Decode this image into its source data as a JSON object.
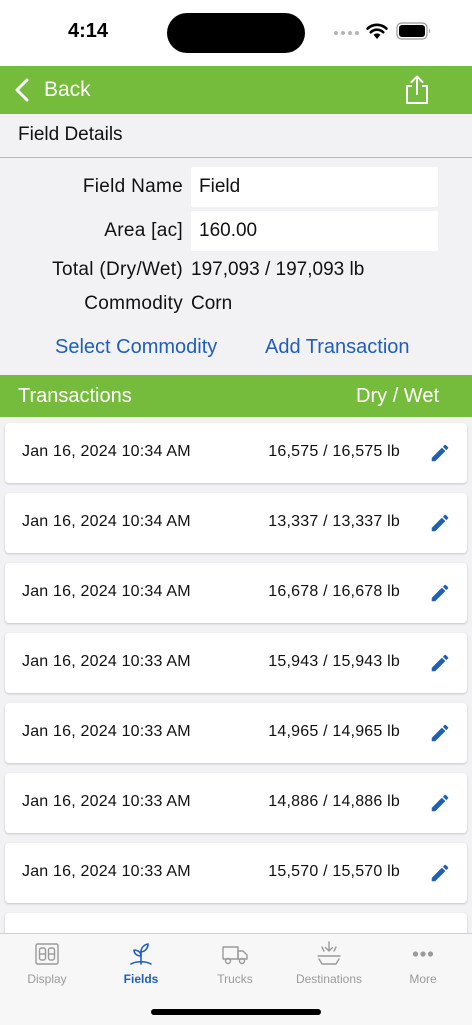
{
  "status_bar": {
    "time": "4:14"
  },
  "nav": {
    "back_label": "Back"
  },
  "section": {
    "title": "Field Details"
  },
  "form": {
    "field_name_label": "Field Name",
    "field_name_value": "Field",
    "area_label": "Area [ac]",
    "area_value": "160.00",
    "total_label": "Total (Dry/Wet)",
    "total_value": "197,093 / 197,093 lb",
    "commodity_label": "Commodity",
    "commodity_value": "Corn"
  },
  "actions": {
    "select_commodity": "Select Commodity",
    "add_transaction": "Add Transaction"
  },
  "transactions": {
    "header_title": "Transactions",
    "header_columns": "Dry / Wet",
    "items": [
      {
        "date": "Jan 16, 2024 10:34 AM",
        "amount": "16,575 / 16,575 lb"
      },
      {
        "date": "Jan 16, 2024 10:34 AM",
        "amount": "13,337 / 13,337 lb"
      },
      {
        "date": "Jan 16, 2024 10:34 AM",
        "amount": "16,678 / 16,678 lb"
      },
      {
        "date": "Jan 16, 2024 10:33 AM",
        "amount": "15,943 / 15,943 lb"
      },
      {
        "date": "Jan 16, 2024 10:33 AM",
        "amount": "14,965 / 14,965 lb"
      },
      {
        "date": "Jan 16, 2024 10:33 AM",
        "amount": "14,886 / 14,886 lb"
      },
      {
        "date": "Jan 16, 2024 10:33 AM",
        "amount": "15,570 / 15,570 lb"
      }
    ]
  },
  "tabs": [
    {
      "label": "Display",
      "icon": "display-icon",
      "active": false
    },
    {
      "label": "Fields",
      "icon": "plant-icon",
      "active": true
    },
    {
      "label": "Trucks",
      "icon": "truck-icon",
      "active": false
    },
    {
      "label": "Destinations",
      "icon": "unload-icon",
      "active": false
    },
    {
      "label": "More",
      "icon": "more-icon",
      "active": false
    }
  ],
  "colors": {
    "brand_green": "#76bc3c",
    "link_blue": "#1f5fb8",
    "tab_inactive": "#9a9a9a"
  }
}
